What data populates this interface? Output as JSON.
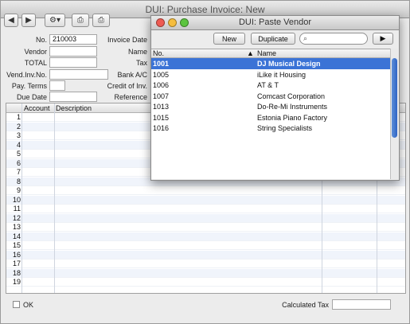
{
  "main_window": {
    "title": "DUI: Purchase Invoice: New",
    "toolbar": {
      "back_icon": "triangle-left-icon",
      "forward_icon": "triangle-right-icon",
      "gear_icon": "gear-icon",
      "print_icon": "print-icon",
      "print_preview_icon": "print-preview-icon"
    },
    "fields": {
      "no_label": "No.",
      "no_value": "210003",
      "vendor_label": "Vendor",
      "total_label": "TOTAL",
      "vend_inv_label": "Vend.Inv.No.",
      "pay_terms_label": "Pay. Terms",
      "due_date_label": "Due Date",
      "invoice_date_label": "Invoice Date",
      "name_label": "Name",
      "tax_label": "Tax",
      "bank_label": "Bank A/C",
      "credit_label": "Credit of Inv.",
      "reference_label": "Reference"
    },
    "grid": {
      "col_account": "Account",
      "col_description": "Description",
      "rows": [
        "1",
        "2",
        "3",
        "4",
        "5",
        "6",
        "7",
        "8",
        "9",
        "10",
        "11",
        "12",
        "13",
        "14",
        "15",
        "16",
        "17",
        "18",
        "19"
      ]
    },
    "footer": {
      "ok_label": "OK",
      "calculated_tax_label": "Calculated Tax"
    }
  },
  "paste_window": {
    "title": "DUI: Paste Vendor",
    "new_button": "New",
    "duplicate_button": "Duplicate",
    "search_placeholder": "",
    "col_no": "No.",
    "col_name": "Name",
    "items": [
      {
        "no": "1001",
        "name": "DJ Musical Design",
        "selected": true
      },
      {
        "no": "1005",
        "name": "iLike it Housing"
      },
      {
        "no": "1006",
        "name": "AT & T"
      },
      {
        "no": "1007",
        "name": "Comcast Corporation"
      },
      {
        "no": "1013",
        "name": "Do-Re-Mi Instruments"
      },
      {
        "no": "1015",
        "name": "Estonia Piano Factory"
      },
      {
        "no": "1016",
        "name": "String Specialists"
      }
    ]
  },
  "colors": {
    "selection": "#3b73d6",
    "close": "#ee5b52",
    "minimize": "#f5bd3f",
    "zoom": "#5cc43f"
  }
}
